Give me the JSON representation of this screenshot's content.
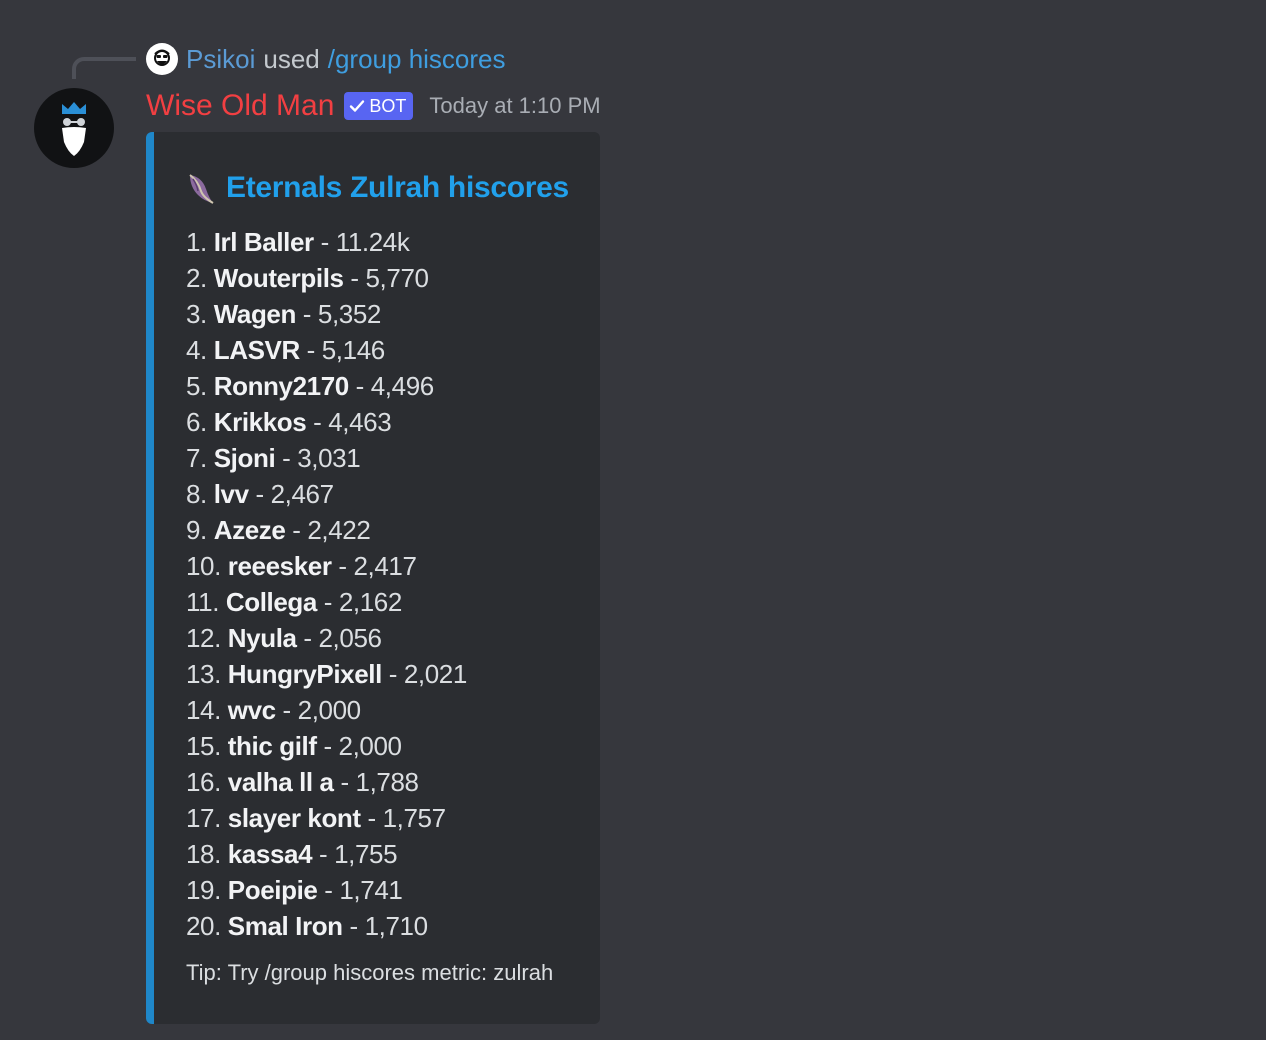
{
  "reply": {
    "username": "Psikoi",
    "used_text": "used",
    "command": "/group hiscores"
  },
  "message": {
    "author": "Wise Old Man",
    "bot_tag": "BOT",
    "timestamp": "Today at 1:10 PM"
  },
  "embed": {
    "accent_color": "#1f87c9",
    "title": "Eternals Zulrah hiscores",
    "title_icon": "zulrah-scale-icon",
    "rows": [
      {
        "rank": "1.",
        "name": "Irl Baller",
        "value": "11.24k"
      },
      {
        "rank": "2.",
        "name": "Wouterpils",
        "value": "5,770"
      },
      {
        "rank": "3.",
        "name": "Wagen",
        "value": "5,352"
      },
      {
        "rank": "4.",
        "name": "LASVR",
        "value": "5,146"
      },
      {
        "rank": "5.",
        "name": "Ronny2170",
        "value": "4,496"
      },
      {
        "rank": "6.",
        "name": "Krikkos",
        "value": "4,463"
      },
      {
        "rank": "7.",
        "name": "Sjoni",
        "value": "3,031"
      },
      {
        "rank": "8.",
        "name": "lvv",
        "value": "2,467"
      },
      {
        "rank": "9.",
        "name": "Azeze",
        "value": "2,422"
      },
      {
        "rank": "10.",
        "name": "reeesker",
        "value": "2,417"
      },
      {
        "rank": "11.",
        "name": "Collega",
        "value": "2,162"
      },
      {
        "rank": "12.",
        "name": "Nyula",
        "value": "2,056"
      },
      {
        "rank": "13.",
        "name": "HungryPixell",
        "value": "2,021"
      },
      {
        "rank": "14.",
        "name": "wvc",
        "value": "2,000"
      },
      {
        "rank": "15.",
        "name": "thic gilf",
        "value": "2,000"
      },
      {
        "rank": "16.",
        "name": "valha ll a",
        "value": "1,788"
      },
      {
        "rank": "17.",
        "name": "slayer kont",
        "value": "1,757"
      },
      {
        "rank": "18.",
        "name": "kassa4",
        "value": "1,755"
      },
      {
        "rank": "19.",
        "name": "Poeipie",
        "value": "1,741"
      },
      {
        "rank": "20.",
        "name": "Smal Iron",
        "value": "1,710"
      }
    ],
    "separator": " - ",
    "footer": "Tip: Try /group hiscores metric: zulrah"
  }
}
